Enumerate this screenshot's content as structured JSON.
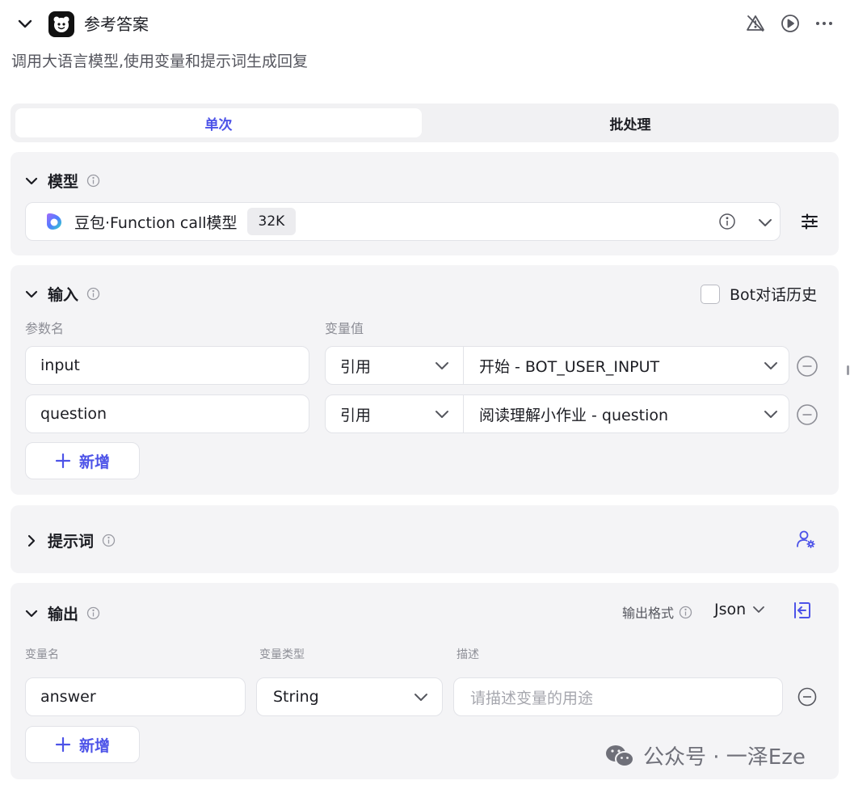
{
  "header": {
    "title": "参考答案",
    "subtitle": "调用大语言模型,使用变量和提示词生成回复"
  },
  "tabs": [
    {
      "label": "单次",
      "active": true
    },
    {
      "label": "批处理",
      "active": false
    }
  ],
  "model_section": {
    "title": "模型",
    "model_name": "豆包·Function call模型",
    "context_badge": "32K"
  },
  "input_section": {
    "title": "输入",
    "bot_history_label": "Bot对话历史",
    "bot_history_checked": false,
    "col_param": "参数名",
    "col_value": "变量值",
    "rows": [
      {
        "name": "input",
        "type": "引用",
        "value": "开始 - BOT_USER_INPUT"
      },
      {
        "name": "question",
        "type": "引用",
        "value": "阅读理解小作业 - question"
      }
    ],
    "add_label": "新增"
  },
  "prompt_section": {
    "title": "提示词"
  },
  "output_section": {
    "title": "输出",
    "format_label": "输出格式",
    "format_value": "Json",
    "col_var": "变量名",
    "col_type": "变量类型",
    "col_desc": "描述",
    "rows": [
      {
        "name": "answer",
        "type": "String",
        "desc_placeholder": "请描述变量的用途"
      }
    ],
    "add_label": "新增"
  },
  "watermark": "公众号 · 一泽Eze",
  "colors": {
    "accent": "#4d53e8",
    "card_bg": "#f4f4f6",
    "text": "#1c1d23"
  }
}
